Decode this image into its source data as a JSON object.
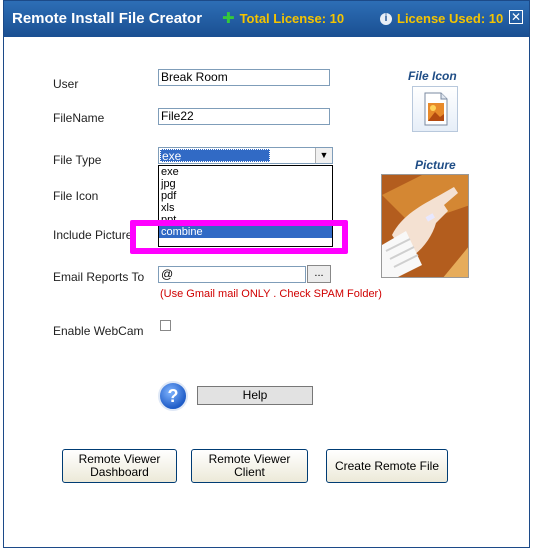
{
  "window": {
    "title": "Remote Install File Creator",
    "total_license": "Total License: 10",
    "license_used": "License Used: 10",
    "close_glyph": "✕"
  },
  "form": {
    "user_label": "User",
    "user_value": "Break Room",
    "filename_label": "FileName",
    "filename_value": "File22",
    "filetype_label": "File Type",
    "filetype_value": "exe",
    "fileicon_label": "File Icon",
    "includepicture_label": "Include Picture",
    "email_label": "Email Reports To",
    "email_value": "@",
    "browse_label": "...",
    "email_warning": "(Use Gmail mail ONLY . Check SPAM Folder)",
    "webcam_label": "Enable WebCam"
  },
  "dropdown_options": [
    "exe",
    "jpg",
    "pdf",
    "xls",
    "ppt",
    "combine"
  ],
  "dropdown_selected": "combine",
  "side": {
    "file_icon_title": "File Icon",
    "picture_title": "Picture"
  },
  "help": {
    "label": "Help",
    "icon_glyph": "?"
  },
  "buttons": {
    "dashboard": "Remote Viewer\nDashboard",
    "client": "Remote Viewer\nClient",
    "create": "Create Remote File"
  },
  "colors": {
    "titlebar": "#1a4f92",
    "license_text": "#f5c400",
    "highlight": "#ff00ff",
    "warning": "#d00000",
    "selection": "#316ac5"
  },
  "icons": {
    "total_license": "plus-icon",
    "license_used": "info-icon",
    "help": "help-icon"
  }
}
